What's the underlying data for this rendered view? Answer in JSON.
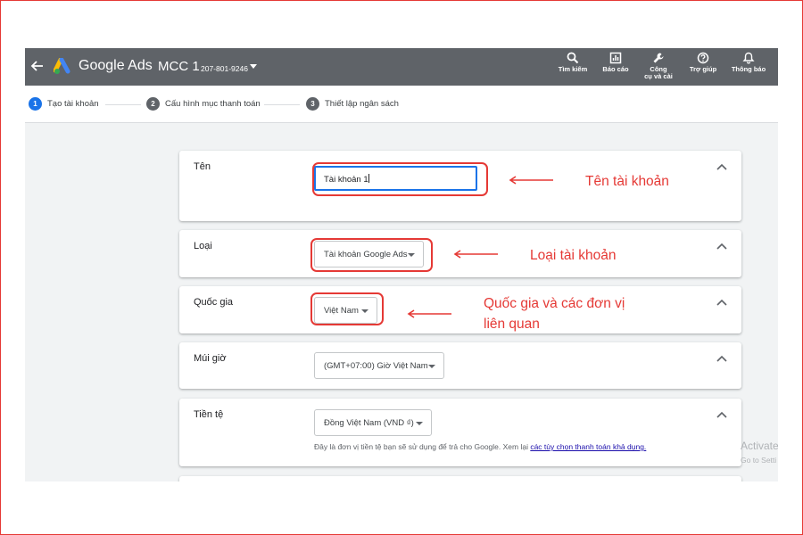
{
  "header": {
    "app_name": "Google Ads",
    "account_name": "MCC 1",
    "account_id": "207-801-9246",
    "bar_color": "#5f6368",
    "tools": [
      {
        "label": "Tìm kiếm",
        "icon": "search-icon"
      },
      {
        "label": "Báo cáo",
        "icon": "reports-icon"
      },
      {
        "label": "Công\ncụ và cài",
        "icon": "wrench-icon"
      },
      {
        "label": "Trợ giúp",
        "icon": "help-icon"
      },
      {
        "label": "Thông báo",
        "icon": "bell-icon"
      }
    ]
  },
  "stepper": {
    "steps": [
      {
        "number": "1",
        "label": "Tạo tài khoản",
        "active": true
      },
      {
        "number": "2",
        "label": "Cấu hình mục thanh toán",
        "active": false
      },
      {
        "number": "3",
        "label": "Thiết lập ngân sách",
        "active": false
      }
    ],
    "active_color": "#1a73e8"
  },
  "form": {
    "name": {
      "label": "Tên",
      "value": "Tài khoản 1"
    },
    "type": {
      "label": "Loại",
      "value": "Tài khoản Google Ads"
    },
    "country": {
      "label": "Quốc gia",
      "value": "Việt Nam"
    },
    "timezone": {
      "label": "Múi giờ",
      "value": "(GMT+07:00) Giờ Việt Nam"
    },
    "currency": {
      "label": "Tiền tệ",
      "value": "Đồng Việt Nam (VND ₫)",
      "helper": "Đây là đơn vị tiền tệ bạn sẽ sử dụng để trả cho Google. Xem lại ",
      "helper_link": "các tùy chọn thanh toán khả dụng."
    }
  },
  "watermark": {
    "line1": "Activate",
    "line2": "Go to Setti"
  },
  "annotations": {
    "color": "#e53935",
    "name_note": "Tên tài khoản",
    "type_note": "Loại tài khoản",
    "country_note": "Quốc gia và các đơn vị\nliên quan"
  }
}
